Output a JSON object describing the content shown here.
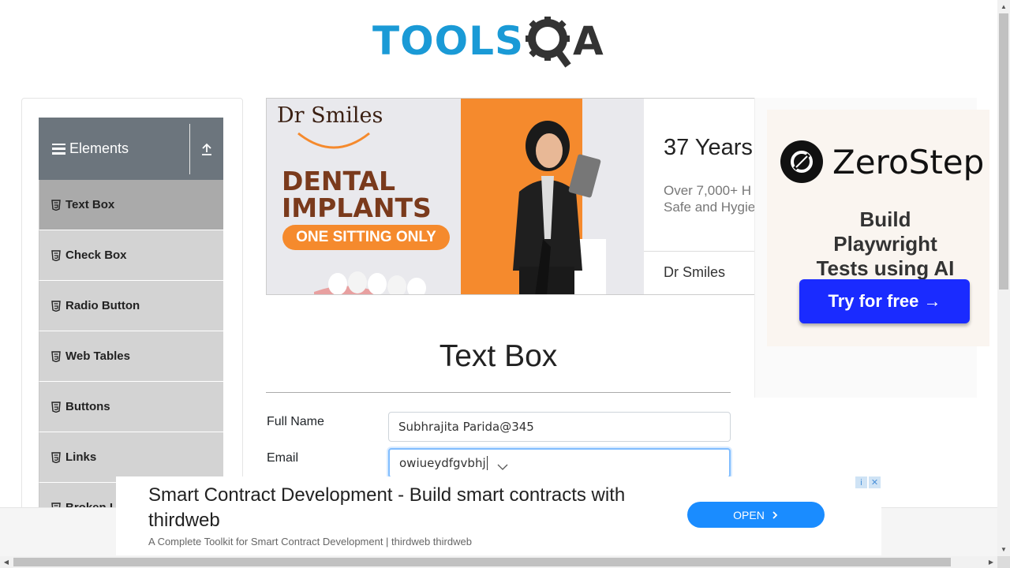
{
  "logo": {
    "text_main": "TOOLS",
    "text_q": "Q",
    "text_a": "A"
  },
  "sidebar": {
    "group_title": "Elements",
    "items": [
      {
        "label": "Text Box",
        "active": true
      },
      {
        "label": "Check Box"
      },
      {
        "label": "Radio Button"
      },
      {
        "label": "Web Tables"
      },
      {
        "label": "Buttons"
      },
      {
        "label": "Links"
      },
      {
        "label": "Broken Links - Images"
      }
    ]
  },
  "ad_top": {
    "brand_logo": "Dr Smiles",
    "headline": "DENTAL IMPLANTS",
    "pill": "ONE SITTING ONLY",
    "title": "37 Years",
    "desc_line1": "Over 7,000+ H",
    "desc_line2": "Safe and Hygie",
    "brand": "Dr Smiles"
  },
  "ad_right": {
    "brand": "ZeroStep",
    "tagline": "Build Playwright Tests using AI",
    "button": "Try for free →"
  },
  "form": {
    "title": "Text Box",
    "full_name_label": "Full Name",
    "full_name_value": "Subhrajita Parida@345",
    "email_label": "Email",
    "email_value": "owiueydfgvbhj"
  },
  "ad_bottom": {
    "title": "Smart Contract Development - Build smart contracts with thirdweb",
    "subtitle": "A Complete Toolkit for Smart Contract Development | thirdweb thirdweb",
    "button": "OPEN",
    "info_icon": "i",
    "close_icon": "✕"
  }
}
